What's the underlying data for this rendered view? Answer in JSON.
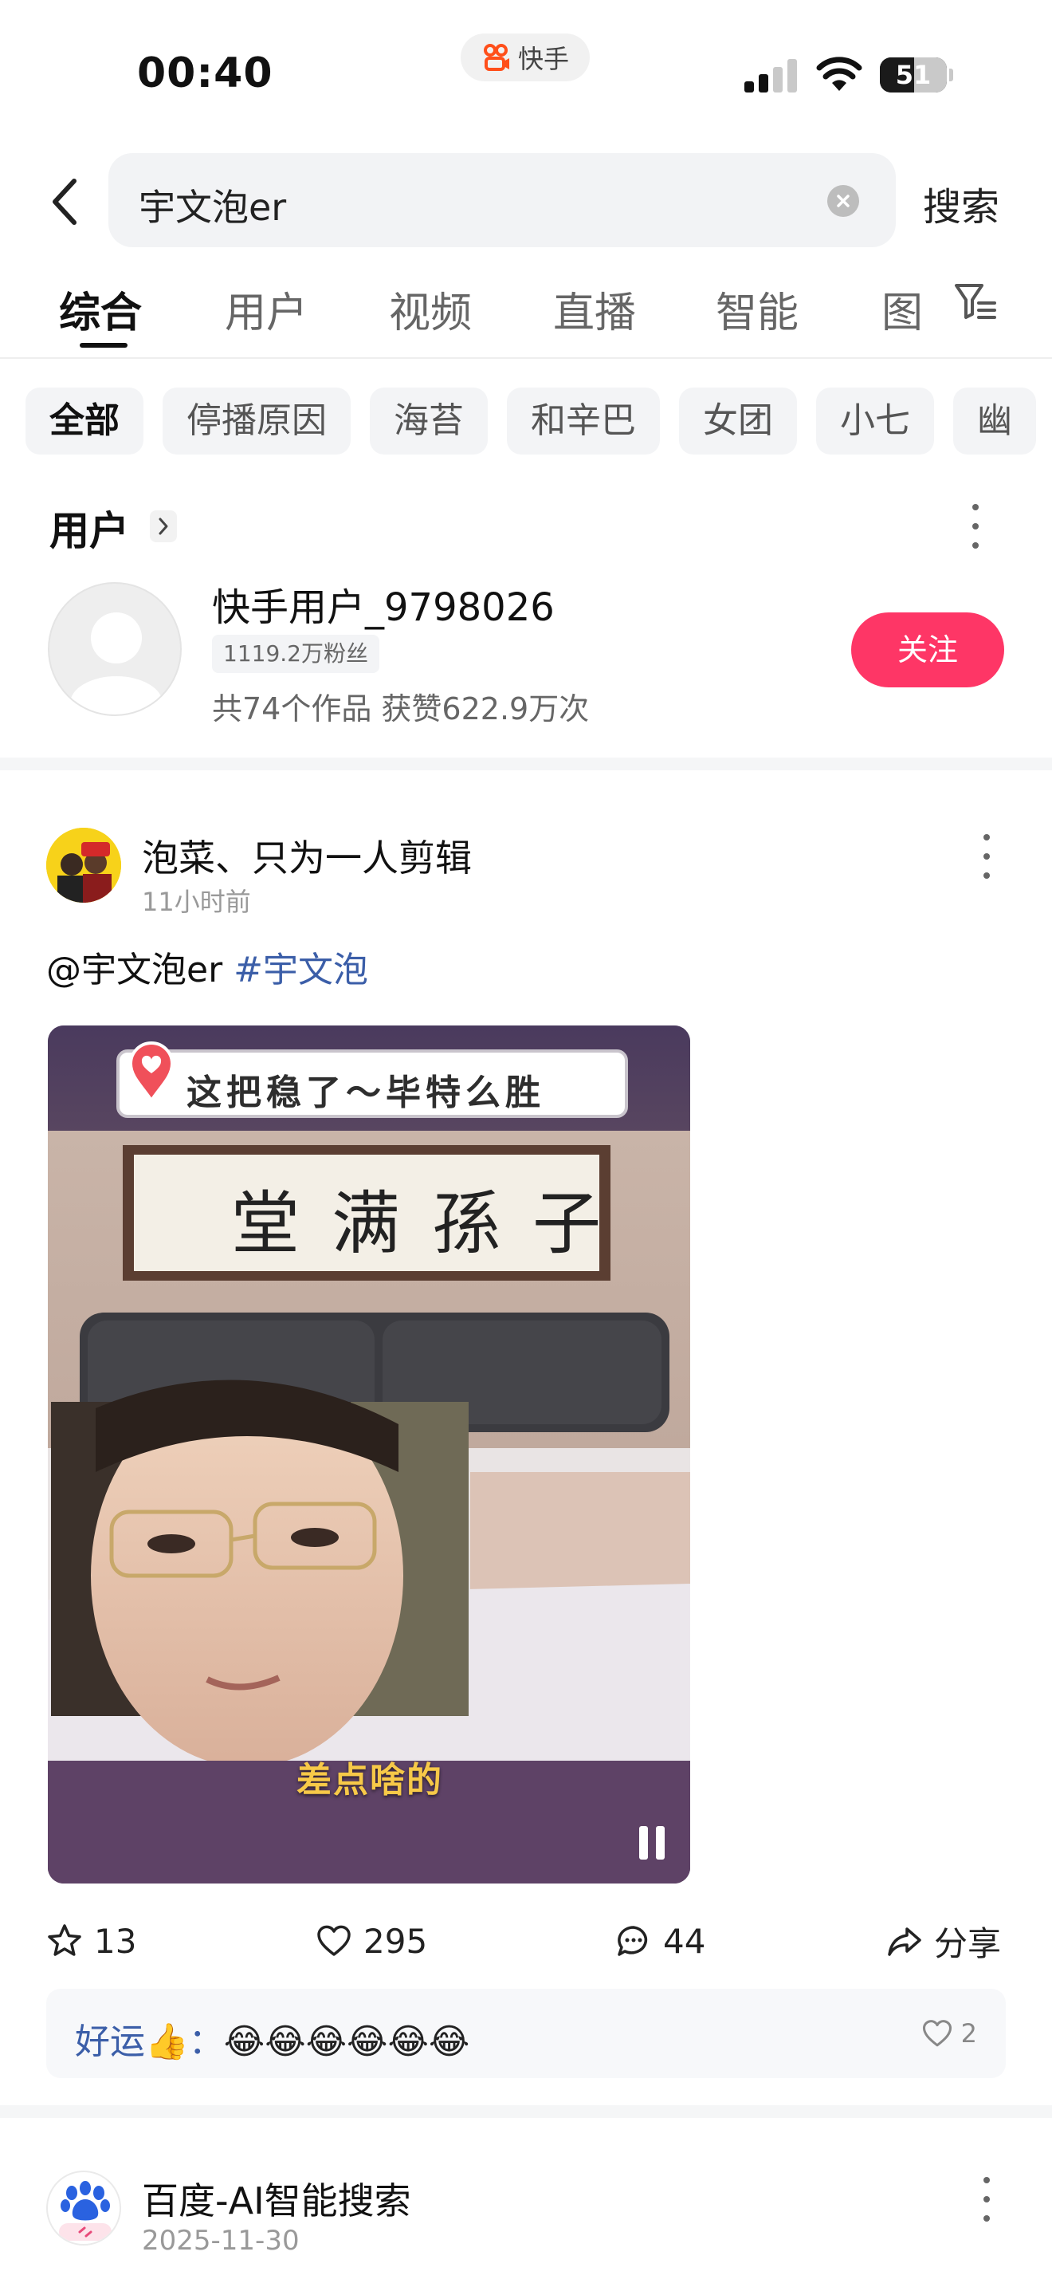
{
  "status_bar": {
    "time": "00:40",
    "app_pill": "快手",
    "battery": "51",
    "battery_level": 0.51
  },
  "search": {
    "query": "宇文泡er",
    "submit_label": "搜索"
  },
  "tabs": [
    {
      "label": "综合",
      "active": true
    },
    {
      "label": "用户",
      "active": false
    },
    {
      "label": "视频",
      "active": false
    },
    {
      "label": "直播",
      "active": false
    },
    {
      "label": "智能",
      "active": false
    },
    {
      "label": "图",
      "active": false
    }
  ],
  "chips": [
    {
      "label": "全部",
      "active": true
    },
    {
      "label": "停播原因",
      "active": false
    },
    {
      "label": "海苔",
      "active": false
    },
    {
      "label": "和辛巴",
      "active": false
    },
    {
      "label": "女团",
      "active": false
    },
    {
      "label": "小七",
      "active": false
    },
    {
      "label": "幽",
      "active": false
    }
  ],
  "user_section": {
    "title": "用户",
    "user": {
      "name": "快手用户_9798026",
      "fans": "1119.2万粉丝",
      "stats": "共74个作品 获赞622.9万次"
    },
    "follow_label": "关注"
  },
  "post": {
    "author": "泡菜、只为一人剪辑",
    "time": "11小时前",
    "mention": "@宇文泡er",
    "hashtag": "#宇文泡",
    "media": {
      "overlay_title": "这把稳了～毕特么胜",
      "subtitle": "差点啥的"
    },
    "actions": {
      "collect": "13",
      "like": "295",
      "comment": "44",
      "share": "分享"
    },
    "top_comment": {
      "prefix": "好运👍：",
      "emojis": "😂😂😂😂😂😂",
      "likes": "2"
    }
  },
  "next_post": {
    "author": "百度-AI智能搜索",
    "time": "2025-11-30"
  },
  "colors": {
    "accent": "#fe3666",
    "link": "#3b5ea8",
    "chip_bg": "#f3f4f6"
  }
}
